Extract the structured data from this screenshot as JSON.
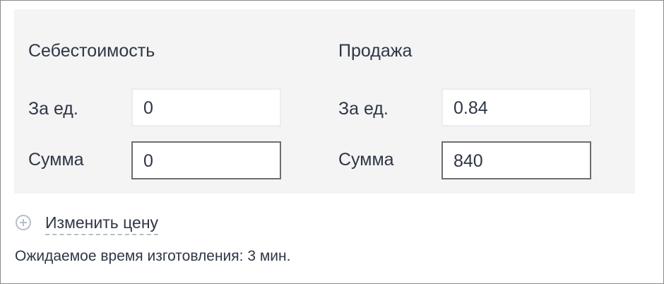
{
  "cost": {
    "heading": "Себестоимость",
    "per_unit_label": "За ед.",
    "per_unit_value": "0",
    "total_label": "Сумма",
    "total_value": "0"
  },
  "sale": {
    "heading": "Продажа",
    "per_unit_label": "За ед.",
    "per_unit_value": "0.84",
    "total_label": "Сумма",
    "total_value": "840"
  },
  "actions": {
    "change_price_label": "Изменить цену",
    "change_price_icon": "plus-circle-icon"
  },
  "eta_text": "Ожидаемое время изготовления: 3 мин.",
  "colors": {
    "panel_bg": "#f4f4f5",
    "text": "#2f3645",
    "active_border": "#6e6e6e",
    "inactive_border": "#ececee",
    "muted": "#b9bdc6"
  }
}
